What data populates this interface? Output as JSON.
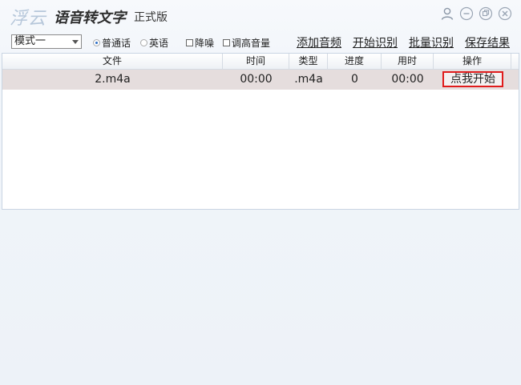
{
  "titlebar": {
    "brand": "浮云",
    "app_name": "语音转文字",
    "edition": "正式版",
    "controls": [
      "user-icon",
      "minimize-icon",
      "restore-icon",
      "close-icon"
    ]
  },
  "toolbar": {
    "mode_select": {
      "value": "模式一"
    },
    "language_options": [
      {
        "label": "普通话",
        "checked": true
      },
      {
        "label": "英语",
        "checked": false
      }
    ],
    "checkboxes": [
      {
        "label": "降噪",
        "checked": false
      },
      {
        "label": "调高音量",
        "checked": false
      }
    ],
    "actions": {
      "add_audio": "添加音频",
      "start_recognition": "开始识别",
      "batch_recognition": "批量识别",
      "save_results": "保存结果"
    }
  },
  "table": {
    "headers": {
      "file": "文件",
      "time": "时间",
      "type": "类型",
      "progress": "进度",
      "elapsed": "用时",
      "action": "操作"
    },
    "rows": [
      {
        "file": "2.m4a",
        "time": "00:00",
        "type": ".m4a",
        "progress": "0",
        "elapsed": "00:00",
        "action": "点我开始"
      }
    ]
  },
  "colors": {
    "accent_border": "#e01b1b",
    "row_bg": "#e5dddd",
    "brand": "#b6c7da"
  }
}
